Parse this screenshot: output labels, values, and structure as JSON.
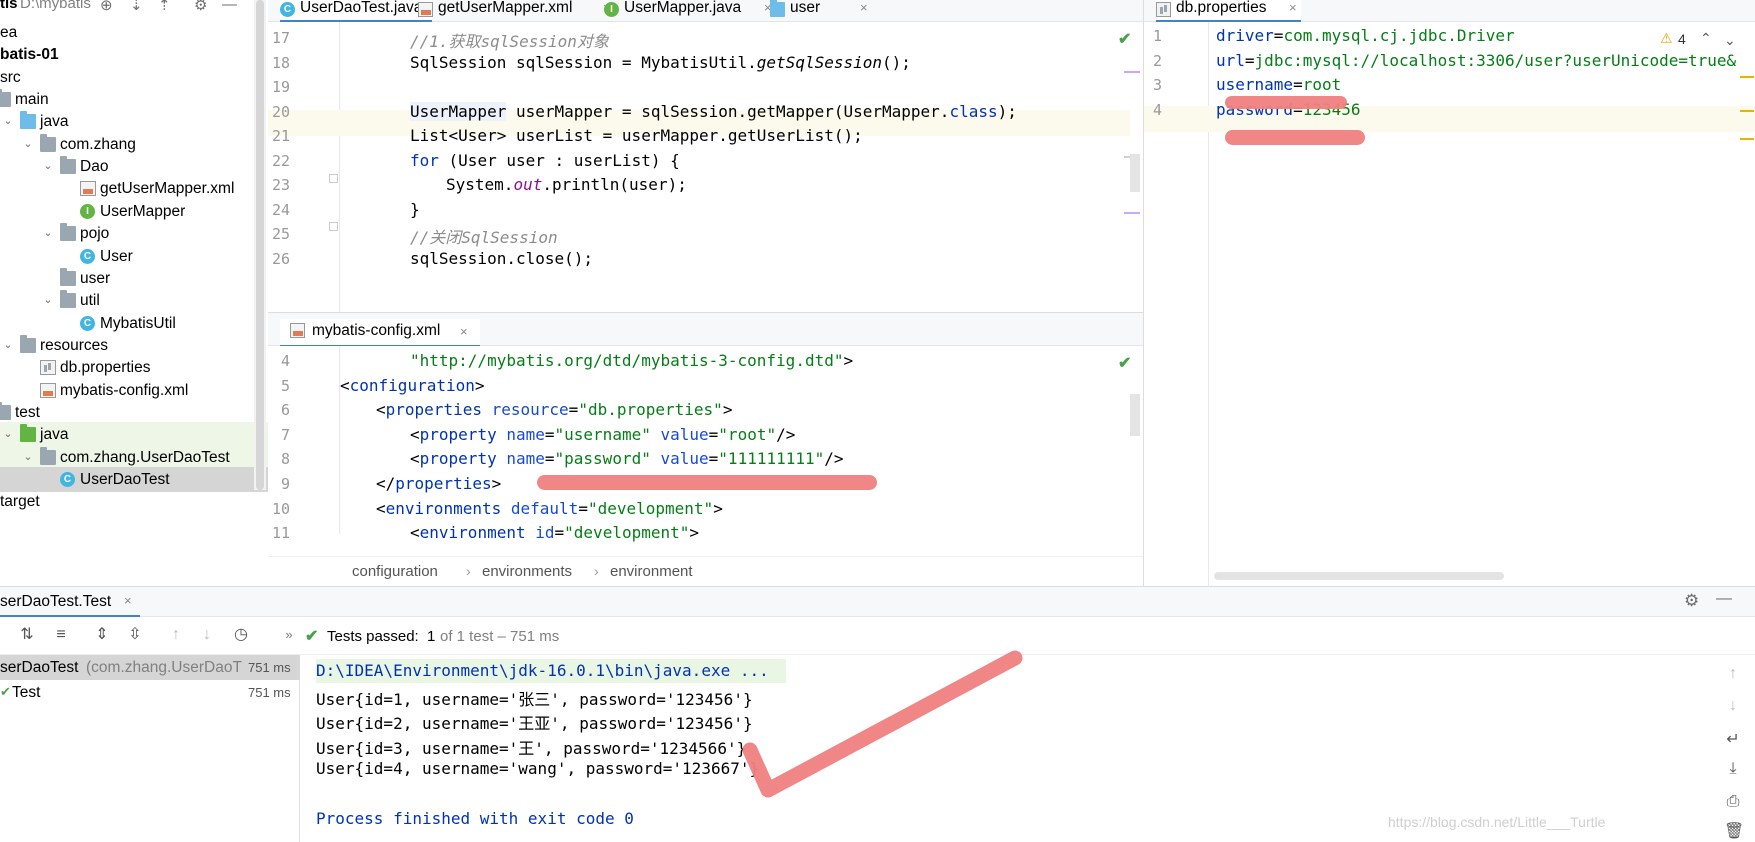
{
  "tree": {
    "header_label": "tis",
    "header_path": "D:\\mybatis",
    "items": [
      {
        "label": "ea",
        "icon": "folder-icon"
      },
      {
        "label": "batis-01",
        "icon": "module-icon"
      },
      {
        "label": "src",
        "icon": "folder-icon"
      },
      {
        "label": "main",
        "icon": "folder-icon"
      },
      {
        "label": "java",
        "icon": "source-folder-icon"
      },
      {
        "label": "com.zhang",
        "icon": "package-icon"
      },
      {
        "label": "Dao",
        "icon": "package-icon"
      },
      {
        "label": "getUserMapper.xml",
        "icon": "xml-file-icon"
      },
      {
        "label": "UserMapper",
        "icon": "interface-icon"
      },
      {
        "label": "pojo",
        "icon": "package-icon"
      },
      {
        "label": "User",
        "icon": "class-icon"
      },
      {
        "label": "user",
        "icon": "package-icon"
      },
      {
        "label": "util",
        "icon": "package-icon"
      },
      {
        "label": "MybatisUtil",
        "icon": "class-icon"
      },
      {
        "label": "resources",
        "icon": "resources-folder-icon"
      },
      {
        "label": "db.properties",
        "icon": "properties-file-icon"
      },
      {
        "label": "mybatis-config.xml",
        "icon": "xml-file-icon"
      },
      {
        "label": "test",
        "icon": "folder-icon"
      },
      {
        "label": "java",
        "icon": "test-source-folder-icon"
      },
      {
        "label": "com.zhang.UserDaoTest",
        "icon": "package-icon"
      },
      {
        "label": "UserDaoTest",
        "icon": "test-class-icon"
      },
      {
        "label": "target",
        "icon": "folder-icon"
      }
    ]
  },
  "top_tabs": [
    {
      "label": "UserDaoTest.java",
      "icon": "class-icon",
      "active": true
    },
    {
      "label": "getUserMapper.xml",
      "icon": "xml-file-icon"
    },
    {
      "label": "UserMapper.java",
      "icon": "interface-icon"
    },
    {
      "label": "user",
      "icon": "package-icon"
    }
  ],
  "tab_close": "×",
  "editor1": {
    "lines": [
      {
        "n": "17",
        "text": "//1.获取sqlSession对象"
      },
      {
        "n": "18",
        "text": "SqlSession sqlSession = MybatisUtil.getSqlSession();"
      },
      {
        "n": "19",
        "text": ""
      },
      {
        "n": "20",
        "text": "UserMapper userMapper = sqlSession.getMapper(UserMapper.class);"
      },
      {
        "n": "21",
        "text": "List<User> userList = userMapper.getUserList();"
      },
      {
        "n": "22",
        "text": "for (User user : userList) {"
      },
      {
        "n": "23",
        "text": "System.out.println(user);"
      },
      {
        "n": "24",
        "text": "}"
      },
      {
        "n": "25",
        "text": "//关闭SqlSession"
      },
      {
        "n": "26",
        "text": "sqlSession.close();"
      }
    ]
  },
  "editor2": {
    "tab": "mybatis-config.xml",
    "lines": [
      {
        "n": "4",
        "text": "\"http://mybatis.org/dtd/mybatis-3-config.dtd\">"
      },
      {
        "n": "5",
        "text": "<configuration>"
      },
      {
        "n": "6",
        "text": "<properties resource=\"db.properties\">"
      },
      {
        "n": "7",
        "text": "<property name=\"username\" value=\"root\"/>"
      },
      {
        "n": "8",
        "text": "<property name=\"password\" value=\"111111111\"/>"
      },
      {
        "n": "9",
        "text": "</properties>"
      },
      {
        "n": "10",
        "text": "<environments default=\"development\">"
      },
      {
        "n": "11",
        "text": "<environment id=\"development\">"
      }
    ],
    "breadcrumb": [
      "configuration",
      "environments",
      "environment"
    ]
  },
  "editor3": {
    "tab": "db.properties",
    "warnings": "4",
    "lines": [
      {
        "n": "1",
        "text": "driver=com.mysql.cj.jdbc.Driver"
      },
      {
        "n": "2",
        "text": "url=jdbc:mysql://localhost:3306/user?userUnicode=true&"
      },
      {
        "n": "3",
        "text": "username=root"
      },
      {
        "n": "4",
        "text": "password=123456"
      }
    ]
  },
  "run": {
    "tab": "serDaoTest.Test",
    "status_prefix": "Tests passed:",
    "passed": "1",
    "status_suffix": "of 1 test – 751 ms",
    "results": [
      {
        "name": "serDaoTest",
        "detail": "(com.zhang.UserDaoT",
        "time": "751 ms"
      },
      {
        "name": "Test",
        "detail": "",
        "time": "751 ms"
      }
    ],
    "console": [
      "D:\\IDEA\\Environment\\jdk-16.0.1\\bin\\java.exe ...",
      "User{id=1, username='张三', password='123456'}",
      "User{id=2, username='王亚', password='123456'}",
      "User{id=3, username='王', password='1234566'}",
      "User{id=4, username='wang', password='123667'}",
      "",
      "Process finished with exit code 0"
    ],
    "watermark": "https://blog.csdn.net/Little___Turtle"
  }
}
